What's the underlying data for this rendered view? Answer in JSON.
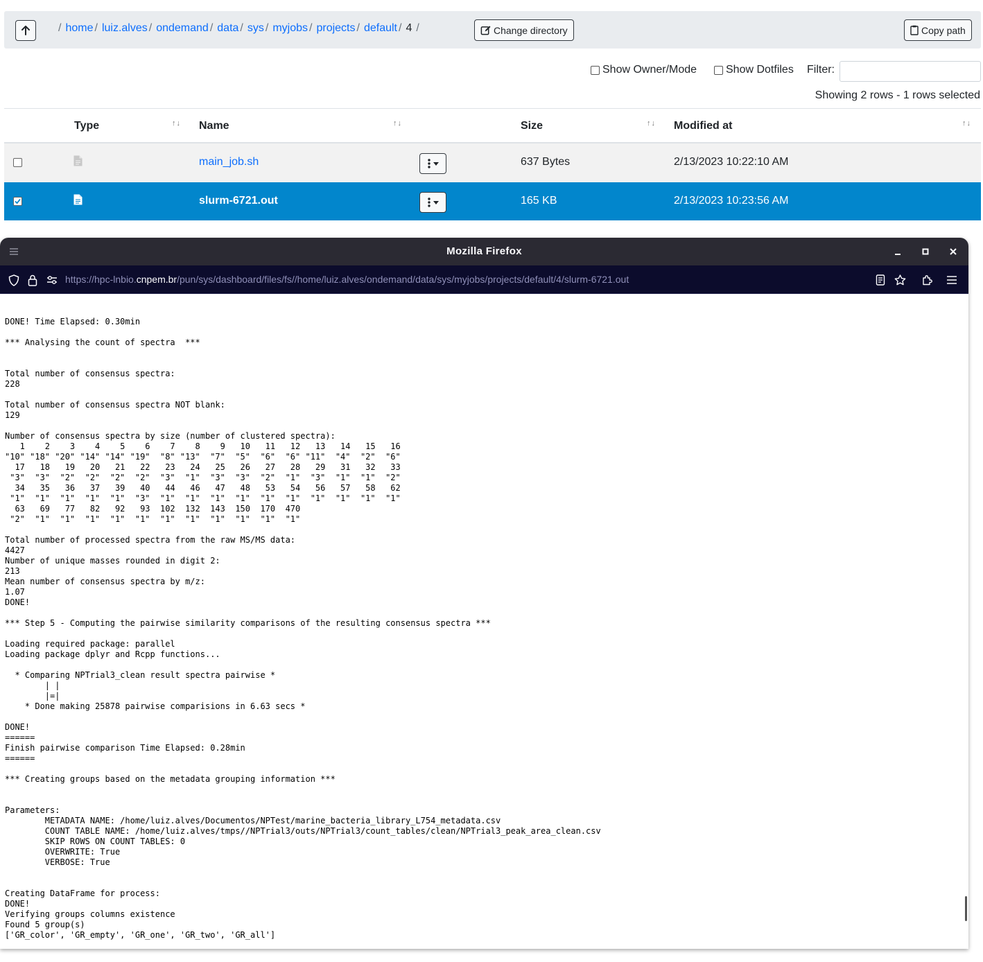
{
  "breadcrumb": {
    "leading_sep": "/",
    "items": [
      "home",
      "luiz.alves",
      "ondemand",
      "data",
      "sys",
      "myjobs",
      "projects",
      "default"
    ],
    "current": "4",
    "trailing_sep": "/",
    "sep": "/"
  },
  "toolbar": {
    "change_directory_label": "Change directory",
    "copy_path_label": "Copy path"
  },
  "options": {
    "show_owner_mode": "Show Owner/Mode",
    "show_dotfiles": "Show Dotfiles",
    "filter_label": "Filter:",
    "filter_value": ""
  },
  "status": {
    "showing": "Showing 2 rows - 1 rows selected"
  },
  "table": {
    "headers": {
      "type": "Type",
      "name": "Name",
      "size": "Size",
      "modified": "Modified at"
    },
    "sort_glyph": "↑↓",
    "rows": [
      {
        "name": "main_job.sh",
        "size": "637 Bytes",
        "modified": "2/13/2023 10:22:10 AM",
        "selected": false
      },
      {
        "name": "slurm-6721.out",
        "size": "165 KB",
        "modified": "2/13/2023 10:23:56 AM",
        "selected": true
      }
    ]
  },
  "browser": {
    "title": "Mozilla Firefox",
    "url_prefix": "https://hpc-lnbio.",
    "url_host": "cnpem.br",
    "url_path": "/pun/sys/dashboard/files/fs//home/luiz.alves/ondemand/data/sys/myjobs/projects/default/4/slurm-6721.out"
  },
  "log_text": "DONE! Time Elapsed: 0.30min\n\n*** Analysing the count of spectra  ***\n\n\nTotal number of consensus spectra:\n228\n\nTotal number of consensus spectra NOT blank:\n129\n\nNumber of consensus spectra by size (number of clustered spectra):\n   1    2    3    4    5    6    7    8    9   10   11   12   13   14   15   16\n\"10\" \"18\" \"20\" \"14\" \"14\" \"19\"  \"8\" \"13\"  \"7\"  \"5\"  \"6\"  \"6\" \"11\"  \"4\"  \"2\"  \"6\"\n  17   18   19   20   21   22   23   24   25   26   27   28   29   31   32   33\n \"3\"  \"3\"  \"2\"  \"2\"  \"2\"  \"2\"  \"3\"  \"1\"  \"3\"  \"3\"  \"2\"  \"1\"  \"3\"  \"1\"  \"1\"  \"2\"\n  34   35   36   37   39   40   44   46   47   48   53   54   56   57   58   62\n \"1\"  \"1\"  \"1\"  \"1\"  \"1\"  \"3\"  \"1\"  \"1\"  \"1\"  \"1\"  \"1\"  \"1\"  \"1\"  \"1\"  \"1\"  \"1\"\n  63   69   77   82   92   93  102  132  143  150  170  470\n \"2\"  \"1\"  \"1\"  \"1\"  \"1\"  \"1\"  \"1\"  \"1\"  \"1\"  \"1\"  \"1\"  \"1\"\n\nTotal number of processed spectra from the raw MS/MS data:\n4427\nNumber of unique masses rounded in digit 2:\n213\nMean number of consensus spectra by m/z:\n1.07\nDONE!\n\n*** Step 5 - Computing the pairwise similarity comparisons of the resulting consensus spectra ***\n\nLoading required package: parallel\nLoading package dplyr and Rcpp functions...\n\n  * Comparing NPTrial3_clean result spectra pairwise *\n        | |\n        |=|\n    * Done making 25878 pairwise comparisions in 6.63 secs *\n\nDONE!\n======\nFinish pairwise comparison Time Elapsed: 0.28min\n======\n\n*** Creating groups based on the metadata grouping information ***\n\n\nParameters:\n        METADATA NAME: /home/luiz.alves/Documentos/NPTest/marine_bacteria_library_L754_metadata.csv\n        COUNT TABLE NAME: /home/luiz.alves/tmps//NPTrial3/outs/NPTrial3/count_tables/clean/NPTrial3_peak_area_clean.csv\n        SKIP ROWS ON COUNT TABLES: 0\n        OVERWRITE: True\n        VERBOSE: True\n\n\nCreating DataFrame for process:\nDONE!\nVerifying groups columns existence\nFound 5 group(s)\n['GR_color', 'GR_empty', 'GR_one', 'GR_two', 'GR_all']"
}
